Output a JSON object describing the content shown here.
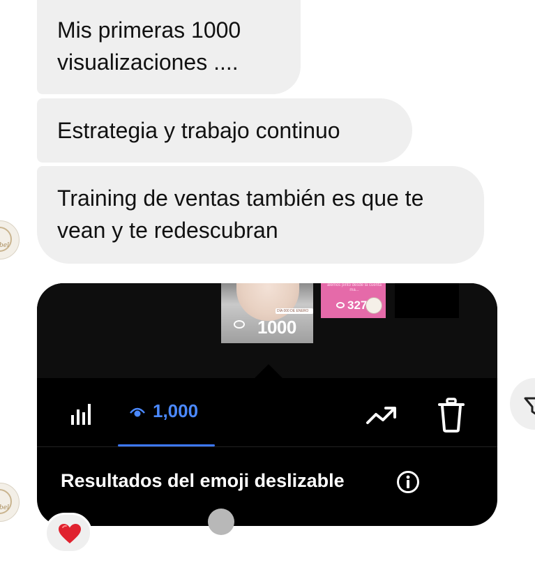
{
  "messages": [
    {
      "text": "Mis primeras 1000 visualizaciones ...."
    },
    {
      "text": "Estrategia y trabajo continuo"
    },
    {
      "text": "Training de ventas también es que te vean y te redescubran"
    }
  ],
  "shared_post": {
    "thumb_main_count": "1000",
    "thumb_main_tag": "DÍA 000 DE ENERO",
    "thumb_pink_caption": "alemos pinto desde la cuenta ma...",
    "thumb_pink_count": "327",
    "views_label": "1,000",
    "footer_title": "Resultados del emoji deslizable",
    "icons": {
      "stats": "bar-chart-icon",
      "eye": "eye-icon",
      "trend": "trend-up-icon",
      "delete": "trash-icon",
      "info": "info-icon"
    },
    "accent_color": "#4b89ff"
  },
  "reaction": {
    "emoji": "❤️"
  },
  "avatar_text": "bel"
}
